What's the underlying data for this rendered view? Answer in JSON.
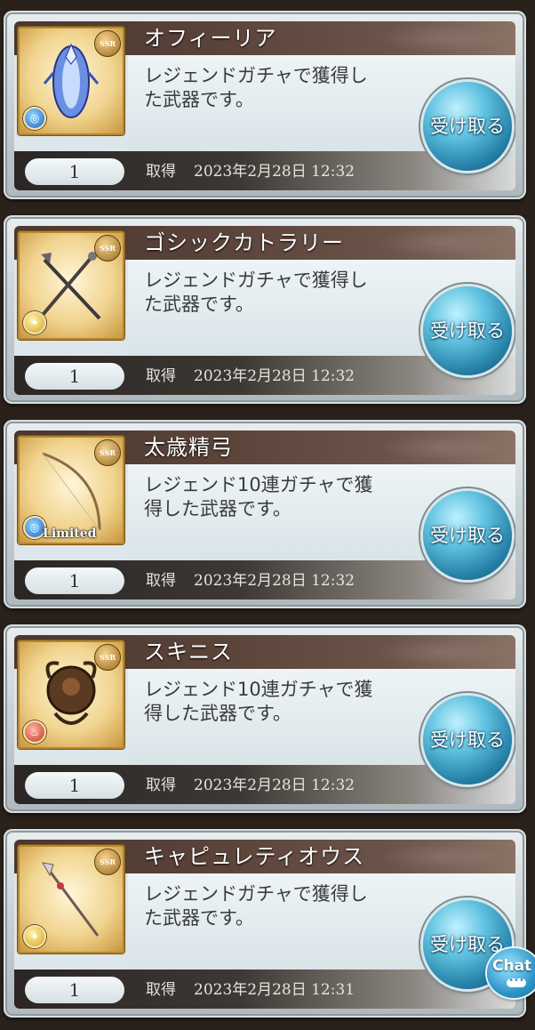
{
  "items": [
    {
      "title": "オフィーリア",
      "desc_line1": "レジェンドガチャで獲得し",
      "desc_line2": "た武器です。",
      "quantity": "1",
      "acquired_label": "取得",
      "acquired_date": "2023年2月28日 12:32",
      "rarity": "SSR",
      "element_icon": "water-element-icon",
      "element_glyph": "◎",
      "limited": "",
      "receive_label": "受け取る"
    },
    {
      "title": "ゴシックカトラリー",
      "desc_line1": "レジェンドガチャで獲得し",
      "desc_line2": "た武器です。",
      "quantity": "1",
      "acquired_label": "取得",
      "acquired_date": "2023年2月28日 12:32",
      "rarity": "SSR",
      "element_icon": "light-element-icon",
      "element_glyph": "✦",
      "limited": "",
      "receive_label": "受け取る"
    },
    {
      "title": "太歳精弓",
      "desc_line1": "レジェンド10連ガチャで獲",
      "desc_line2": "得した武器です。",
      "quantity": "1",
      "acquired_label": "取得",
      "acquired_date": "2023年2月28日 12:32",
      "rarity": "SSR",
      "element_icon": "water-element-icon",
      "element_glyph": "◎",
      "limited": "Limited",
      "receive_label": "受け取る"
    },
    {
      "title": "スキニス",
      "desc_line1": "レジェンド10連ガチャで獲",
      "desc_line2": "得した武器です。",
      "quantity": "1",
      "acquired_label": "取得",
      "acquired_date": "2023年2月28日 12:32",
      "rarity": "SSR",
      "element_icon": "fire-element-icon",
      "element_glyph": "♨",
      "limited": "",
      "receive_label": "受け取る"
    },
    {
      "title": "キャピュレティオウス",
      "desc_line1": "レジェンドガチャで獲得し",
      "desc_line2": "た武器です。",
      "quantity": "1",
      "acquired_label": "取得",
      "acquired_date": "2023年2月28日 12:31",
      "rarity": "SSR",
      "element_icon": "light-element-icon",
      "element_glyph": "✦",
      "limited": "",
      "receive_label": "受け取る"
    }
  ],
  "chat": {
    "label": "Chat",
    "dots": "•••"
  },
  "colors": {
    "title_bar": "#4a3730",
    "receive_button": "#2681a8",
    "frame": "#b6862e"
  }
}
